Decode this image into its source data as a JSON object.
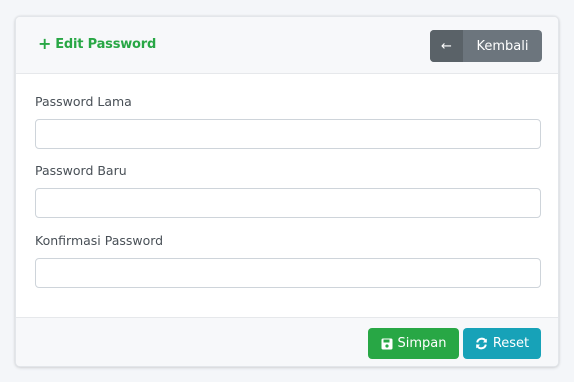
{
  "card": {
    "title": "Edit Password",
    "title_icon": "plus-icon",
    "back_button": {
      "label": "Kembali",
      "icon": "arrow-left-icon"
    }
  },
  "form": {
    "fields": [
      {
        "label": "Password Lama",
        "value": "",
        "placeholder": ""
      },
      {
        "label": "Password Baru",
        "value": "",
        "placeholder": ""
      },
      {
        "label": "Konfirmasi Password",
        "value": "",
        "placeholder": ""
      }
    ]
  },
  "footer": {
    "save_button": {
      "label": "Simpan",
      "icon": "save-icon"
    },
    "reset_button": {
      "label": "Reset",
      "icon": "sync-icon"
    }
  },
  "colors": {
    "success": "#28a745",
    "info": "#17a2b8",
    "secondary": "#6c757d"
  }
}
